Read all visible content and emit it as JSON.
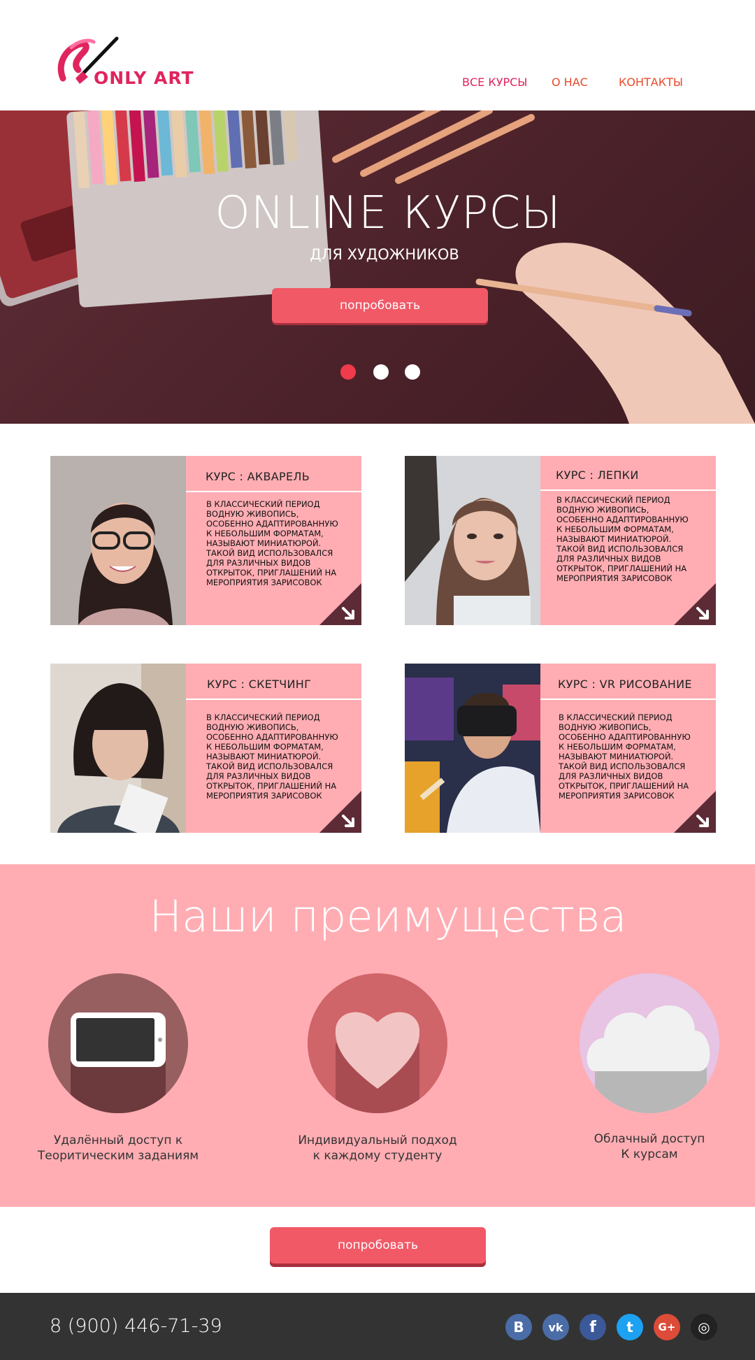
{
  "header": {
    "logo_text": "ONLY ART",
    "nav": [
      "ВСЕ КУРСЫ",
      "О НАС",
      "КОНТАКТЫ"
    ]
  },
  "hero": {
    "title": "ONLINE КУРСЫ",
    "subtitle": "ДЛЯ ХУДОЖНИКОВ",
    "button": "попробовать",
    "slides_total": 3,
    "active_slide": 1
  },
  "courses": [
    {
      "title": "КУРС : АКВАРЕЛЬ",
      "desc": "В КЛАССИЧЕСКИЙ ПЕРИОД ВОДНУЮ ЖИВОПИСЬ, ОСОБЕННО АДАПТИРОВАННУЮ К НЕБОЛЬШИМ ФОРМАТАМ, НАЗЫВАЮТ МИНИАТЮРОЙ. ТАКОЙ ВИД ИСПОЛЬЗОВАЛСЯ ДЛЯ РАЗЛИЧНЫХ ВИДОВ ОТКРЫТОК, ПРИГЛАШЕНИЙ НА МЕРОПРИЯТИЯ ЗАРИСОВОК"
    },
    {
      "title": "КУРС : ЛЕПКИ",
      "desc": "В КЛАССИЧЕСКИЙ ПЕРИОД ВОДНУЮ ЖИВОПИСЬ, ОСОБЕННО АДАПТИРОВАННУЮ К НЕБОЛЬШИМ ФОРМАТАМ, НАЗЫВАЮТ МИНИАТЮРОЙ. ТАКОЙ ВИД ИСПОЛЬЗОВАЛСЯ ДЛЯ РАЗЛИЧНЫХ ВИДОВ ОТКРЫТОК, ПРИГЛАШЕНИЙ НА МЕРОПРИЯТИЯ ЗАРИСОВОК"
    },
    {
      "title": "КУРС : СКЕТЧИНГ",
      "desc": "В КЛАССИЧЕСКИЙ ПЕРИОД ВОДНУЮ ЖИВОПИСЬ, ОСОБЕННО АДАПТИРОВАННУЮ К НЕБОЛЬШИМ ФОРМАТАМ, НАЗЫВАЮТ МИНИАТЮРОЙ. ТАКОЙ ВИД ИСПОЛЬЗОВАЛСЯ ДЛЯ РАЗЛИЧНЫХ ВИДОВ ОТКРЫТОК, ПРИГЛАШЕНИЙ НА МЕРОПРИЯТИЯ ЗАРИСОВОК"
    },
    {
      "title": "КУРС : VR РИСОВАНИЕ",
      "desc": "В КЛАССИЧЕСКИЙ ПЕРИОД ВОДНУЮ ЖИВОПИСЬ, ОСОБЕННО АДАПТИРОВАННУЮ К НЕБОЛЬШИМ ФОРМАТАМ, НАЗЫВАЮТ МИНИАТЮРОЙ. ТАКОЙ ВИД ИСПОЛЬЗОВАЛСЯ ДЛЯ РАЗЛИЧНЫХ ВИДОВ ОТКРЫТОК, ПРИГЛАШЕНИЙ НА МЕРОПРИЯТИЯ ЗАРИСОВОК"
    }
  ],
  "advantages": {
    "title": "Наши преимущества",
    "items": [
      {
        "icon": "tablet-icon",
        "line1": "Удалённый доступ к",
        "line2": "Теоритическим заданиям"
      },
      {
        "icon": "heart-icon",
        "line1": "Индивидуальный подход",
        "line2": "к каждому студенту"
      },
      {
        "icon": "cloud-icon",
        "line1": "Облачный доступ",
        "line2": "К курсам"
      }
    ]
  },
  "cta_button": "попробовать",
  "footer": {
    "phone": "8 (900) 446-71-39",
    "social": [
      {
        "icon": "vk-b-icon",
        "glyph": "B",
        "color": "#4a6da7"
      },
      {
        "icon": "vk-icon",
        "glyph": "vk",
        "color": "#4a6da7"
      },
      {
        "icon": "facebook-icon",
        "glyph": "f",
        "color": "#3b5998"
      },
      {
        "icon": "twitter-icon",
        "glyph": "t",
        "color": "#1da1f2"
      },
      {
        "icon": "google-plus-icon",
        "glyph": "G+",
        "color": "#dd4b39"
      },
      {
        "icon": "instagram-icon",
        "glyph": "◎",
        "color": "#222222"
      }
    ]
  },
  "colors": {
    "accent": "#f15967",
    "pink": "#ffadb3",
    "brand": "#e0245e",
    "dark": "#333333"
  }
}
